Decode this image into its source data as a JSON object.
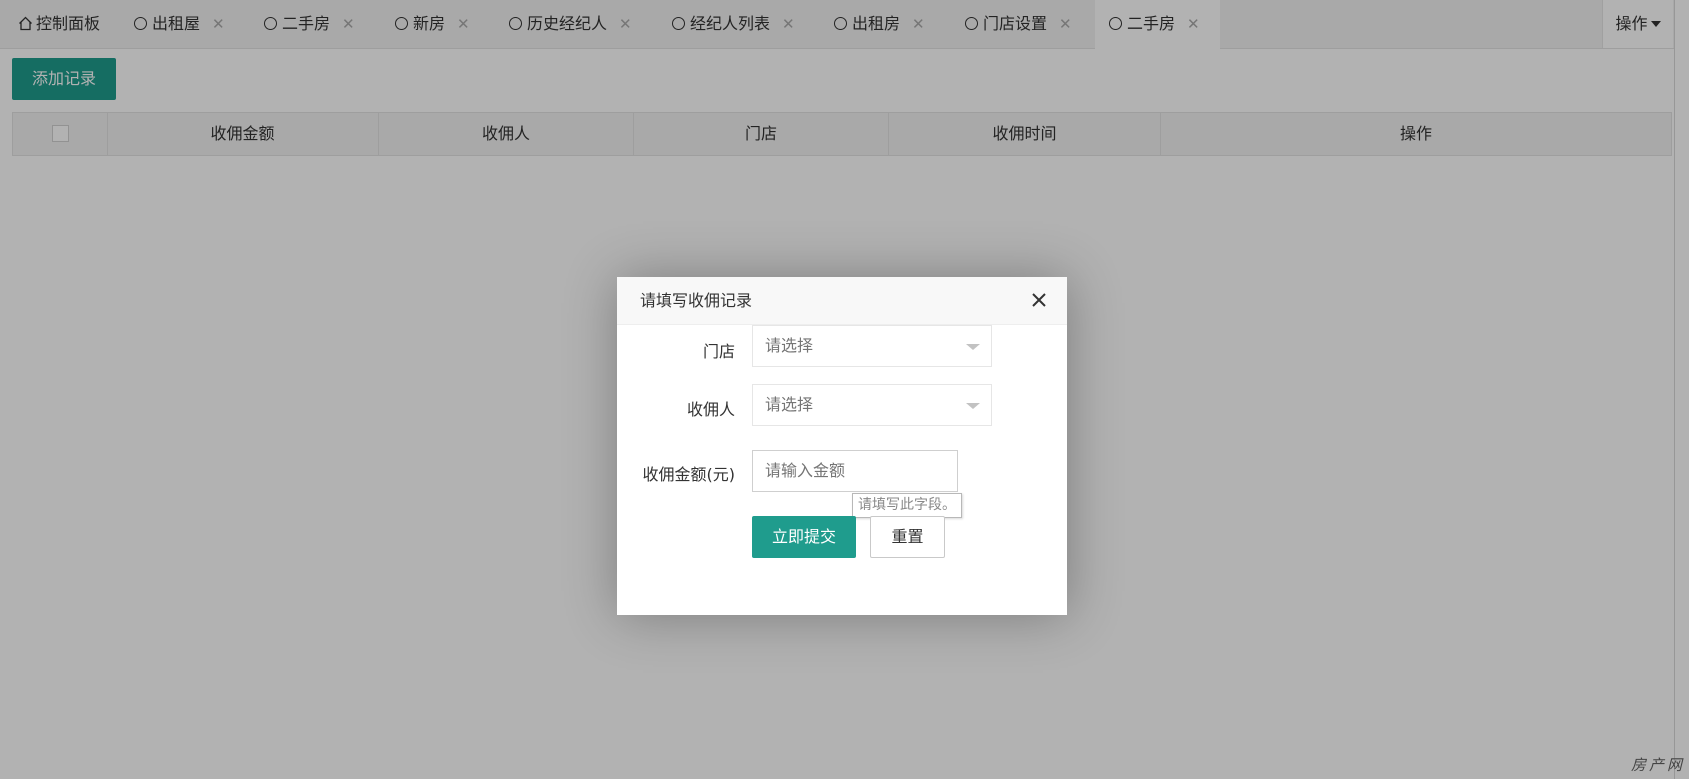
{
  "tabs": {
    "home": "控制面板",
    "items": [
      "出租屋",
      "二手房",
      "新房",
      "历史经纪人",
      "经纪人列表",
      "出租房",
      "门店设置",
      "二手房"
    ],
    "close_glyph": "✕",
    "operate": "操作"
  },
  "toolbar": {
    "add_label": "添加记录"
  },
  "table": {
    "headers": [
      "收佣金额",
      "收佣人",
      "门店",
      "收佣时间",
      "操作"
    ]
  },
  "modal": {
    "title": "请填写收佣记录",
    "fields": {
      "store": {
        "label": "门店",
        "placeholder": "请选择"
      },
      "collector": {
        "label": "收佣人",
        "placeholder": "请选择"
      },
      "amount": {
        "label": "收佣金额(元)",
        "placeholder": "请输入金额"
      }
    },
    "validation_tip": "请填写此字段。",
    "submit_label": "立即提交",
    "reset_label": "重置"
  },
  "watermark": "房产网",
  "colors": {
    "accent": "#1f9c8d",
    "overlay": "rgba(0,0,0,0.3)"
  }
}
